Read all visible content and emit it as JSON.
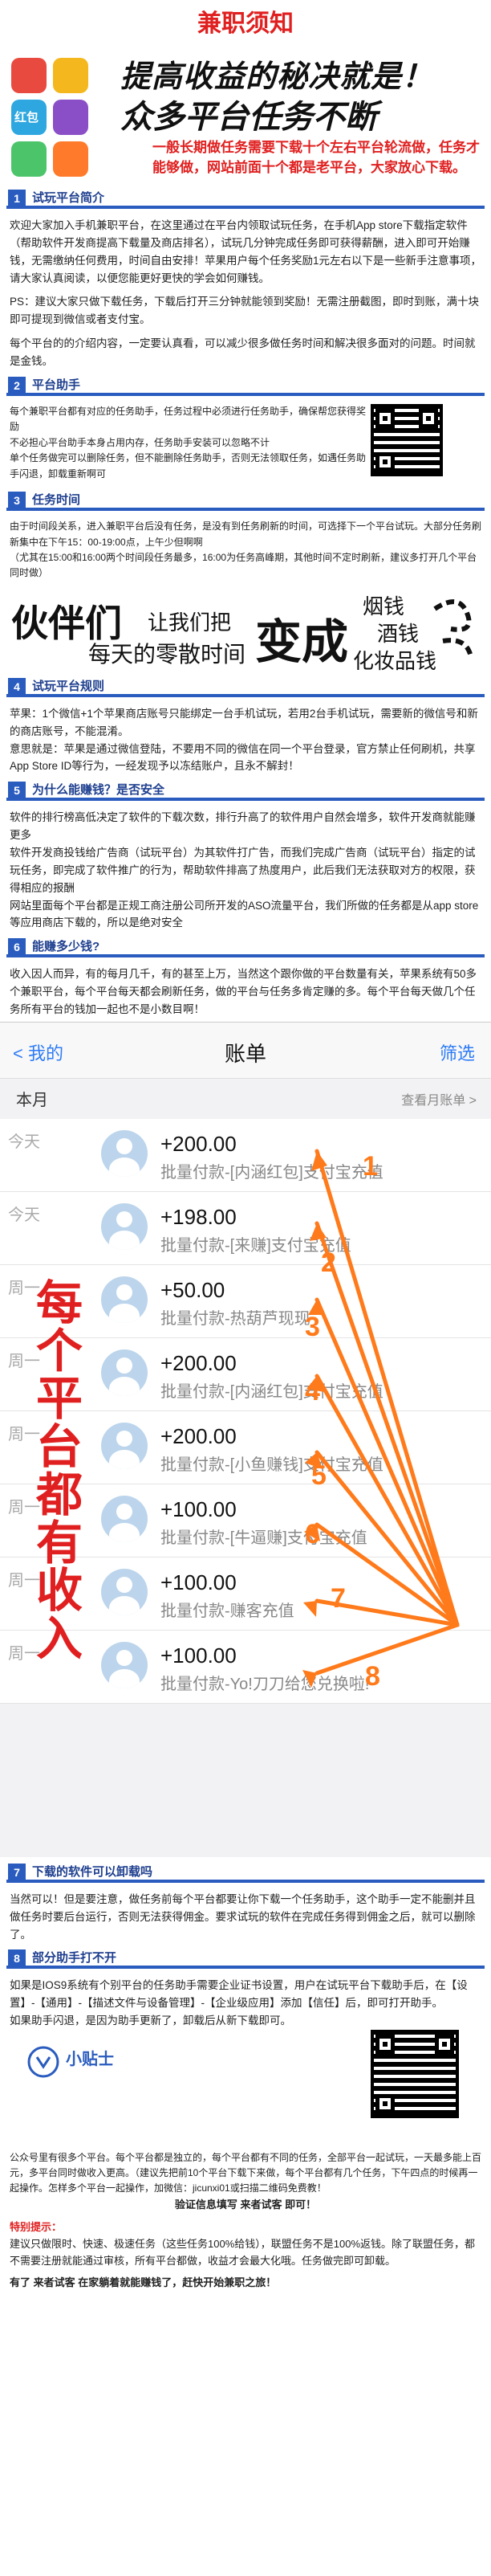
{
  "page_title": "兼职须知",
  "hero": {
    "app_tile_labels": [
      "红包"
    ],
    "slogan_line1": "提高收益的秘决就是！",
    "slogan_line2": "众多平台任务不断",
    "slogan_red": "一般长期做任务需要下载十个左右平台轮流做，任务才能够做，网站前面十个都是老平台，大家放心下载。"
  },
  "sections": [
    {
      "num": "1",
      "title": "试玩平台简介",
      "paras": [
        "欢迎大家加入手机兼职平台，在这里通过在平台内领取试玩任务，在手机App store下载指定软件（帮助软件开发商提高下载量及商店排名），试玩几分钟完成任务即可获得薪酬，进入即可开始赚钱，无需缴纳任何费用，时间自由安排！苹果用户每个任务奖励1元左右以下是一些新手注意事项，请大家认真阅读，以便您能更好更快的学会如何赚钱。",
        "PS：建议大家只做下载任务，下载后打开三分钟就能领到奖励！无需注册截图，即时到账，满十块即可提现到微信或者支付宝。",
        "每个平台的的介绍内容，一定要认真看，可以减少很多做任务时间和解决很多面对的问题。时间就是金钱。"
      ]
    },
    {
      "num": "2",
      "title": "平台助手",
      "paras": [
        "每个兼职平台都有对应的任务助手，任务过程中必须进行任务助手，确保帮您获得奖励",
        "不必担心平台助手本身占用内存，任务助手安装可以忽略不计",
        "单个任务做完可以删除任务，但不能删除任务助手，否则无法领取任务，如遇任务助手闪退，卸载重新啊可"
      ]
    },
    {
      "num": "3",
      "title": "任务时间",
      "paras": [
        "由于时间段关系，进入兼职平台后没有任务，是没有到任务刷新的时间，可选择下一个平台试玩。大部分任务刷新集中在下午15：00-19:00点，上午少但啊啊",
        "（尤其在15:00和16:00两个时间段任务最多，16:00为任务高峰期，其他时间不定时刷新，建议多打开几个平台同时做）"
      ]
    },
    {
      "num": "4",
      "title": "试玩平台规则",
      "paras": [
        "苹果：1个微信+1个苹果商店账号只能绑定一台手机试玩，若用2台手机试玩，需要新的微信号和新的商店账号，不能混淆。",
        "意思就是：苹果是通过微信登陆，不要用不同的微信在同一个平台登录，官方禁止任何刷机，共享App Store ID等行为，一经发现予以冻结账户，且永不解封！"
      ]
    },
    {
      "num": "5",
      "title": "为什么能赚钱？是否安全",
      "paras": [
        "软件的排行榜高低决定了软件的下载次数，排行升高了的软件用户自然会增多，软件开发商就能赚更多",
        "软件开发商投钱给广告商（试玩平台）为其软件打广告，而我们完成广告商（试玩平台）指定的试玩任务，即完成了软件推广的行为，帮助软件排高了热度用户，此后我们无法获取对方的权限，获得相应的报酬",
        "网站里面每个平台都是正规工商注册公司所开发的ASO流量平台，我们所做的任务都是从app store等应用商店下载的，所以是绝对安全"
      ]
    },
    {
      "num": "6",
      "title": "能赚多少钱?",
      "paras": [
        "收入因人而异，有的每月几千，有的甚至上万，当然这个跟你做的平台数量有关，苹果系统有50多个兼职平台，每个平台每天都会刷新任务，做的平台与任务多肯定赚的多。每个平台每天做几个任务所有平台的钱加一起也不是小数目啊！"
      ]
    }
  ],
  "partner_banner": {
    "line1_big": "伙伴们",
    "line1_small": "让我们把",
    "line2": "每天的零散时间",
    "line3": "变成",
    "items": [
      "烟钱",
      "酒钱",
      "化妆品钱"
    ]
  },
  "bill_screen": {
    "back_label": "< 我的",
    "title": "账单",
    "filter_label": "筛选",
    "month_label": "本月",
    "view_month_label": "查看月账单 >",
    "big_vertical_text": "每个平台都有收入",
    "rows": [
      {
        "day": "今天",
        "amount": "+200.00",
        "desc": "批量付款-[内涵红包]支付宝充值"
      },
      {
        "day": "今天",
        "amount": "+198.00",
        "desc": "批量付款-[来赚]支付宝充值"
      },
      {
        "day": "周一",
        "amount": "+50.00",
        "desc": "批量付款-热葫芦现现"
      },
      {
        "day": "周一",
        "amount": "+200.00",
        "desc": "批量付款-[内涵红包]支付宝充值"
      },
      {
        "day": "周一",
        "amount": "+200.00",
        "desc": "批量付款-[小鱼赚钱]支付宝充值"
      },
      {
        "day": "周一",
        "amount": "+100.00",
        "desc": "批量付款-[牛逼赚]支付宝充值"
      },
      {
        "day": "周一",
        "amount": "+100.00",
        "desc": "批量付款-赚客充值"
      },
      {
        "day": "周一",
        "amount": "+100.00",
        "desc": "批量付款-Yo!刀刀给您兑换啦!"
      }
    ],
    "arrow_numbers": [
      "1",
      "2",
      "3",
      "4",
      "5",
      "6",
      "7",
      "8"
    ],
    "accent_color": "#ff7a1a"
  },
  "sections_b": [
    {
      "num": "7",
      "title": "下载的软件可以卸载吗",
      "paras": [
        "当然可以！但是要注意，做任务前每个平台都要让你下载一个任务助手，这个助手一定不能删并且做任务时要后台运行，否则无法获得佣金。要求试玩的软件在完成任务得到佣金之后，就可以删除了。"
      ]
    },
    {
      "num": "8",
      "title": "部分助手打不开",
      "paras": [
        "如果是IOS9系统有个别平台的任务助手需要企业证书设置，用户在试玩平台下载助手后，在【设置】-【通用】-【描述文件与设备管理】-【企业级应用】添加【信任】后，即可打开助手。",
        "如果助手闪退，是因为助手更新了，卸载后从新下载即可。"
      ]
    }
  ],
  "tips": {
    "title": "小贴士",
    "para": "公众号里有很多个平台。每个平台都是独立的，每个平台都有不同的任务，全部平台一起试玩，一天最多能上百元，多平台同时做收入更高。（建议先把前10个平台下载下来做，每个平台都有几个任务，下午四点的时候再一起操作。怎样多个平台一起操作，加微信：jicunxi01或扫描二维码免费教！",
    "verify": "验证信息填写 来者试客 即可！"
  },
  "special_tips": {
    "title": "特别提示：",
    "para": "建议只做限时、快速、极速任务（这些任务100%给钱），联盟任务不是100%返钱。除了联盟任务，都不需要注册就能通过审核，所有平台都做，收益才会最大化哦。任务做完即可卸载。",
    "footer": "有了 来者试客 在家躺着就能赚钱了，赶快开始兼职之旅！"
  }
}
